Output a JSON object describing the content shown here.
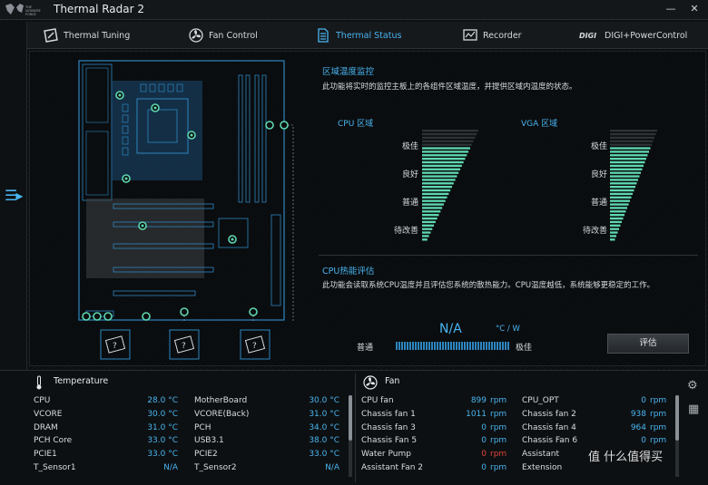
{
  "app": {
    "title": "Thermal Radar 2",
    "logo_text": "THE ULTIMATE FORCE"
  },
  "tabs": [
    {
      "label": "Thermal Tuning",
      "icon": "thermal-tuning-icon",
      "active": false
    },
    {
      "label": "Fan Control",
      "icon": "fan-control-icon",
      "active": false
    },
    {
      "label": "Thermal Status",
      "icon": "thermal-status-icon",
      "active": true
    },
    {
      "label": "Recorder",
      "icon": "recorder-icon",
      "active": false
    },
    {
      "label": "DIGI+PowerControl",
      "icon": "digi-icon",
      "active": false
    }
  ],
  "zone_monitor": {
    "title": "区域温度监控",
    "desc": "此功能将实时的监控主板上的各组件区域温度，并提供区域内温度的状态。",
    "cpu_zone": "CPU 区域",
    "vga_zone": "VGA 区域",
    "levels": [
      "极佳",
      "良好",
      "普通",
      "待改善"
    ]
  },
  "cpu_eval": {
    "title": "CPU热能评估",
    "desc": "此功能会读取系统CPU温度并且评估您系统的散热能力。CPU温度越低，系统能够更稳定的工作。",
    "value": "N/A",
    "unit": "°C / W",
    "low_label": "普通",
    "high_label": "极佳",
    "button": "评估"
  },
  "temperature": {
    "title": "Temperature",
    "rows_left": [
      {
        "label": "CPU",
        "value": "28.0 °C"
      },
      {
        "label": "VCORE",
        "value": "30.0 °C"
      },
      {
        "label": "DRAM",
        "value": "31.0 °C"
      },
      {
        "label": "PCH Core",
        "value": "33.0 °C"
      },
      {
        "label": "PCIE1",
        "value": "33.0 °C"
      },
      {
        "label": "T_Sensor1",
        "value": "N/A"
      }
    ],
    "rows_right": [
      {
        "label": "MotherBoard",
        "value": "30.0 °C"
      },
      {
        "label": "VCORE(Back)",
        "value": "31.0 °C"
      },
      {
        "label": "PCH",
        "value": "34.0 °C"
      },
      {
        "label": "USB3.1",
        "value": "38.0 °C"
      },
      {
        "label": "PCIE2",
        "value": "33.0 °C"
      },
      {
        "label": "T_Sensor2",
        "value": "N/A"
      }
    ]
  },
  "fan": {
    "title": "Fan",
    "unit": "rpm",
    "rows_left": [
      {
        "label": "CPU fan",
        "value": "899",
        "alert": false
      },
      {
        "label": "Chassis fan 1",
        "value": "1011",
        "alert": false
      },
      {
        "label": "Chassis fan 3",
        "value": "0",
        "alert": false
      },
      {
        "label": "Chassis Fan 5",
        "value": "0",
        "alert": false
      },
      {
        "label": "Water Pump",
        "value": "0",
        "alert": true
      },
      {
        "label": "Assistant Fan 2",
        "value": "0",
        "alert": false
      }
    ],
    "rows_right": [
      {
        "label": "CPU_OPT",
        "value": "0"
      },
      {
        "label": "Chassis fan 2",
        "value": "938"
      },
      {
        "label": "Chassis fan 4",
        "value": "964"
      },
      {
        "label": "Chassis Fan 6",
        "value": "0"
      },
      {
        "label": "Assistant",
        "value": ""
      },
      {
        "label": "Extension",
        "value": ""
      }
    ]
  },
  "colors": {
    "accent": "#49b4f0",
    "bar": "#5fd8b0",
    "alert": "#e0443b",
    "background": "#0b0d0f"
  },
  "watermark": "值 什么值得买"
}
